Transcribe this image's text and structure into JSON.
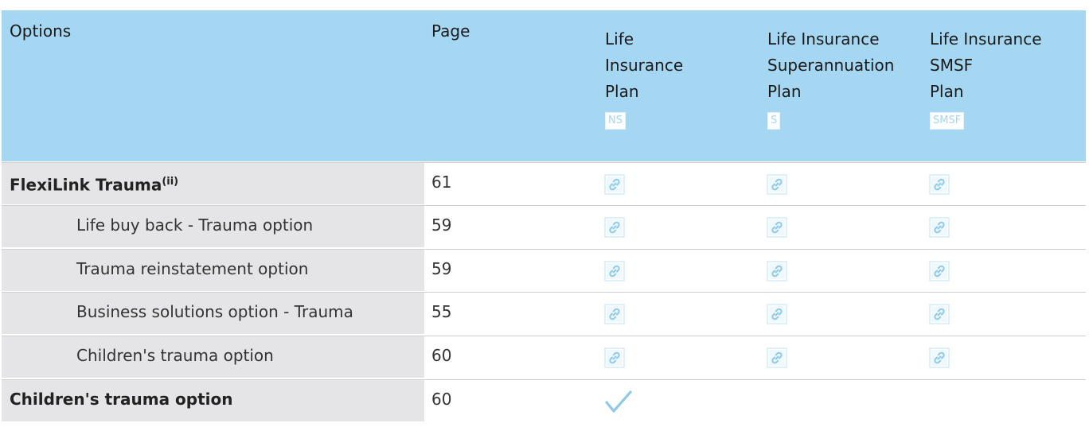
{
  "table": {
    "headers": {
      "options": "Options",
      "page": "Page",
      "col1": {
        "lines": [
          "Life",
          "Insurance",
          "Plan"
        ],
        "badge": "NS"
      },
      "col2": {
        "lines": [
          "Life Insurance",
          "Superannuation",
          "Plan"
        ],
        "badge": "S"
      },
      "col3": {
        "lines": [
          "Life Insurance",
          "SMSF",
          "Plan"
        ],
        "badge": "SMSF"
      }
    },
    "rows": [
      {
        "label": "FlexiLink Trauma",
        "sup": "(ii)",
        "page": "61",
        "marks": [
          "link-icon",
          "link-icon",
          "link-icon"
        ]
      },
      {
        "label": "Life buy back - Trauma option",
        "page": "59",
        "marks": [
          "link-icon",
          "link-icon",
          "link-icon"
        ]
      },
      {
        "label": "Trauma reinstatement option",
        "page": "59",
        "marks": [
          "link-icon",
          "link-icon",
          "link-icon"
        ]
      },
      {
        "label": "Business solutions option - Trauma",
        "page": "55",
        "marks": [
          "link-icon",
          "link-icon",
          "link-icon"
        ]
      },
      {
        "label": "Children's trauma option",
        "page": "60",
        "marks": [
          "link-icon",
          "link-icon",
          "link-icon"
        ]
      },
      {
        "label": "Children's trauma option",
        "page": "60",
        "marks": [
          "checkmark-icon",
          "",
          ""
        ]
      }
    ]
  },
  "colors": {
    "header_bg": "#a5d7f2",
    "label_bg": "#e5e5e7",
    "icon": "#8ec9ea"
  }
}
